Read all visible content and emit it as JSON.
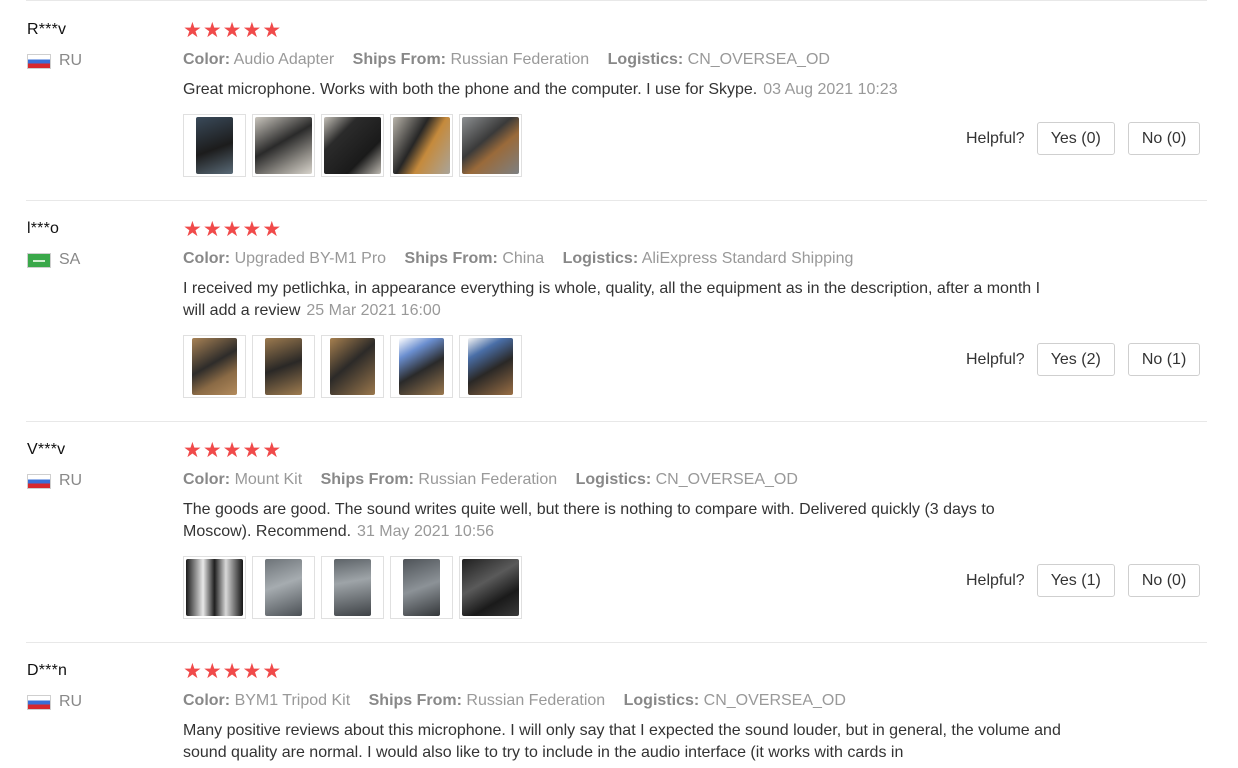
{
  "helpful_label": "Helpful?",
  "labels": {
    "color": "Color:",
    "ships_from": "Ships From:",
    "logistics": "Logistics:"
  },
  "star_color": "#f04a4a",
  "reviews": [
    {
      "user": "R***v",
      "country": "RU",
      "flag": "russia-flag-icon",
      "rating": 5,
      "color": "Audio Adapter",
      "ships_from": "Russian Federation",
      "logistics": "CN_OVERSEA_OD",
      "text": "Great microphone. Works with both the phone and the computer. I use for Skype.",
      "date": "03 Aug 2021 10:23",
      "photos": [
        "black-microphone-photo",
        "microphone-kit-photo",
        "black-case-photo",
        "cables-photo",
        "device-on-case-photo"
      ],
      "yes": "Yes (0)",
      "no": "No (0)"
    },
    {
      "user": "l***o",
      "country": "SA",
      "flag": "saudi-flag-icon",
      "rating": 5,
      "color": "Upgraded BY-M1 Pro",
      "ships_from": "China",
      "logistics": "AliExpress Standard Shipping",
      "text": "I received my petlichka, in appearance everything is whole, quality, all the equipment as in the description, after a month I will add a review",
      "date": "25 Mar 2021 16:00",
      "photos": [
        "parcel-photo",
        "microphone-on-box-photo",
        "accessories-photo",
        "packaging-photo",
        "box-open-photo"
      ],
      "yes": "Yes (2)",
      "no": "No (1)"
    },
    {
      "user": "V***v",
      "country": "RU",
      "flag": "russia-flag-icon",
      "rating": 5,
      "color": "Mount Kit",
      "ships_from": "Russian Federation",
      "logistics": "CN_OVERSEA_OD",
      "text": "The goods are good. The sound writes quite well, but there is nothing to compare with. Delivered quickly (3 days to Moscow). Recommend.",
      "date": "31 May 2021 10:56",
      "photos": [
        "box-contents-photo",
        "mini-tripod-photo",
        "clip-mount-photo",
        "pouch-photo",
        "dark-case-photo"
      ],
      "yes": "Yes (1)",
      "no": "No (0)"
    },
    {
      "user": "D***n",
      "country": "RU",
      "flag": "russia-flag-icon",
      "rating": 5,
      "color": "BYM1 Tripod Kit",
      "ships_from": "Russian Federation",
      "logistics": "CN_OVERSEA_OD",
      "text": "Many positive reviews about this microphone. I will only say that I expected the sound louder, but in general, the volume and sound quality are normal. I would also like to try to include in the audio interface (it works with cards in",
      "date": "",
      "photos": [],
      "yes": "",
      "no": ""
    }
  ]
}
